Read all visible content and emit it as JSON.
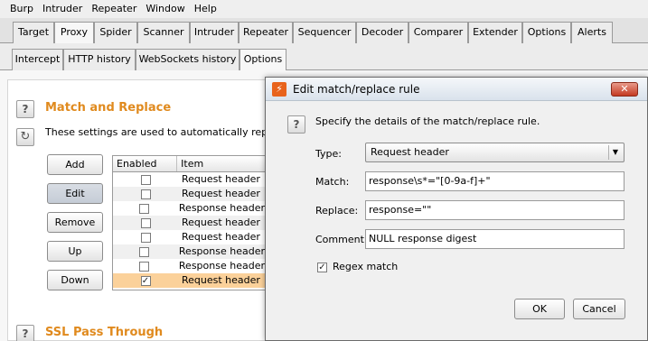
{
  "menubar": {
    "items": [
      "Burp",
      "Intruder",
      "Repeater",
      "Window",
      "Help"
    ]
  },
  "main_tabs": [
    "Target",
    "Proxy",
    "Spider",
    "Scanner",
    "Intruder",
    "Repeater",
    "Sequencer",
    "Decoder",
    "Comparer",
    "Extender",
    "Options",
    "Alerts"
  ],
  "sub_tabs": [
    "Intercept",
    "HTTP history",
    "WebSockets history",
    "Options"
  ],
  "match_replace": {
    "title": "Match and Replace",
    "description": "These settings are used to automatically replace p",
    "buttons": {
      "add": "Add",
      "edit": "Edit",
      "remove": "Remove",
      "up": "Up",
      "down": "Down"
    },
    "columns": {
      "enabled": "Enabled",
      "item": "Item"
    },
    "rows": [
      {
        "enabled": false,
        "item": "Request header"
      },
      {
        "enabled": false,
        "item": "Request header"
      },
      {
        "enabled": false,
        "item": "Response header"
      },
      {
        "enabled": false,
        "item": "Request header"
      },
      {
        "enabled": false,
        "item": "Request header"
      },
      {
        "enabled": false,
        "item": "Response header"
      },
      {
        "enabled": false,
        "item": "Response header"
      },
      {
        "enabled": true,
        "item": "Request header"
      }
    ]
  },
  "ssl_pass_through": {
    "title": "SSL Pass Through"
  },
  "dialog": {
    "title": "Edit match/replace rule",
    "instruction": "Specify the details of the match/replace rule.",
    "type_label": "Type:",
    "type_value": "Request header",
    "match_label": "Match:",
    "match_value": "response\\s*=\"[0-9a-f]+\"",
    "replace_label": "Replace:",
    "replace_value": "response=\"\"",
    "comment_label": "Comment:",
    "comment_value": "NULL response digest",
    "regex_label": "Regex match",
    "regex_checked": true,
    "ok_label": "OK",
    "cancel_label": "Cancel"
  },
  "colors": {
    "section_title": "#e08a1e",
    "selected_row": "#fbd19a"
  }
}
